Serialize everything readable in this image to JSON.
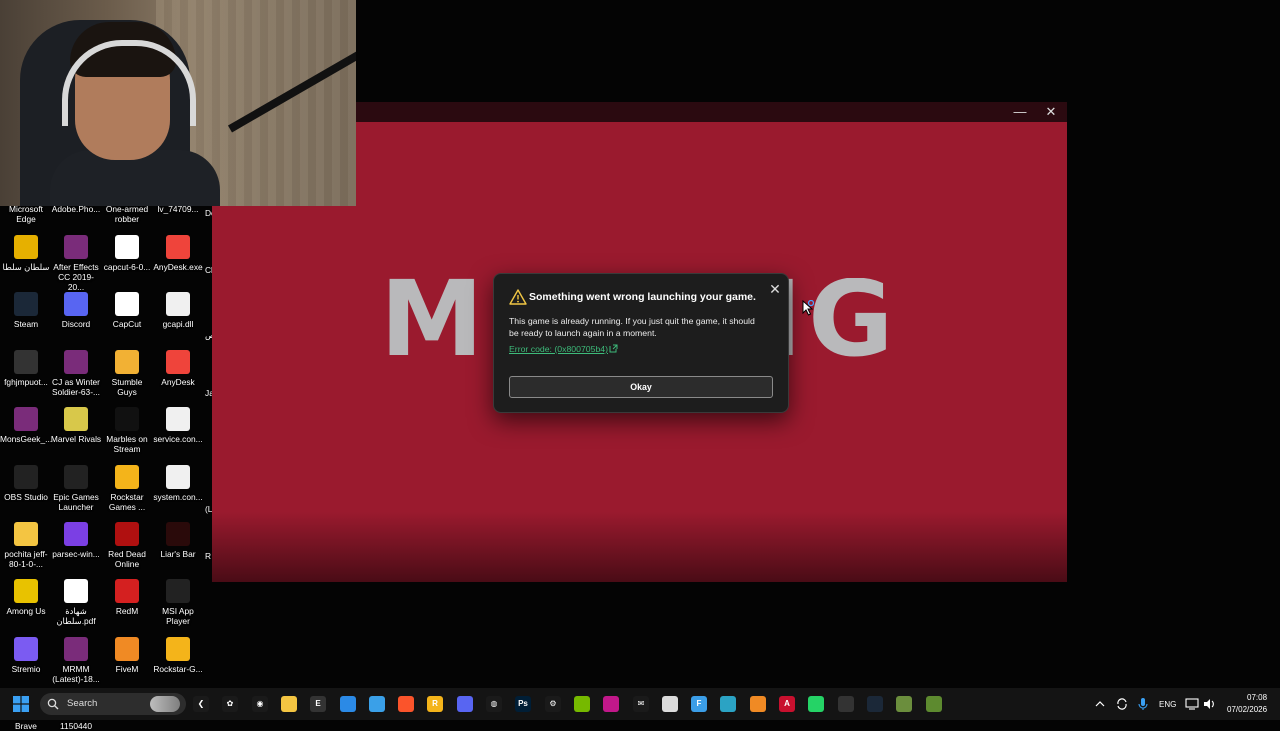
{
  "launcher": {
    "logo_text": "MOJANG",
    "minimize_glyph": "—",
    "close_glyph": "✕"
  },
  "dialog": {
    "title": "Something went wrong launching your game.",
    "message": "This game is already running. If you just quit the game, it should be ready to launch again in a moment.",
    "error_code": "Error code: (0x800705b4)",
    "ok_label": "Okay",
    "close_glyph": "✕"
  },
  "desktop": {
    "partial_top": [
      "Microsoft Edge",
      "Adobe.Pho...",
      "One-armed robber",
      "lv_74709..."
    ],
    "icons": [
      {
        "label": "سلطان سلطا",
        "icon": "chrome-icon",
        "color": "#e6b000"
      },
      {
        "label": "After Effects CC 2019-20...",
        "icon": "winrar-icon",
        "color": "#7a2c7a"
      },
      {
        "label": "capcut-6-0...",
        "icon": "capcut-icon",
        "color": "#ffffff"
      },
      {
        "label": "AnyDesk.exe",
        "icon": "anydesk-icon",
        "color": "#ef443b"
      },
      {
        "label": "Steam",
        "icon": "steam-icon",
        "color": "#1b2838"
      },
      {
        "label": "Discord",
        "icon": "discord-icon",
        "color": "#5865f2"
      },
      {
        "label": "CapCut",
        "icon": "capcut-icon",
        "color": "#ffffff"
      },
      {
        "label": "gcapi.dll",
        "icon": "file-icon",
        "color": "#f0f0f0"
      },
      {
        "label": "fghjmpuot...",
        "icon": "keyboard-icon",
        "color": "#333333"
      },
      {
        "label": "CJ as Winter Soldier-63-...",
        "icon": "winrar-icon",
        "color": "#7a2c7a"
      },
      {
        "label": "Stumble Guys",
        "icon": "stumble-guys-icon",
        "color": "#f2b134"
      },
      {
        "label": "AnyDesk",
        "icon": "anydesk-icon",
        "color": "#ef443b"
      },
      {
        "label": "MonsGeek_...",
        "icon": "winrar-icon",
        "color": "#7a2c7a"
      },
      {
        "label": "Marvel Rivals",
        "icon": "marvel-rivals-icon",
        "color": "#d8c84a"
      },
      {
        "label": "Marbles on Stream",
        "icon": "marbles-icon",
        "color": "#111111"
      },
      {
        "label": "service.con...",
        "icon": "file-icon",
        "color": "#f0f0f0"
      },
      {
        "label": "OBS Studio",
        "icon": "obs-icon",
        "color": "#222222"
      },
      {
        "label": "Epic Games Launcher",
        "icon": "epic-games-icon",
        "color": "#222222"
      },
      {
        "label": "Rockstar Games ...",
        "icon": "rockstar-icon",
        "color": "#f4b41a"
      },
      {
        "label": "system.con...",
        "icon": "file-icon",
        "color": "#f0f0f0"
      },
      {
        "label": "pochita jeff-80-1-0-...",
        "icon": "folder-icon",
        "color": "#f4c542"
      },
      {
        "label": "parsec-win...",
        "icon": "parsec-icon",
        "color": "#7b3fe4"
      },
      {
        "label": "Red Dead Online",
        "icon": "red-dead-icon",
        "color": "#b01010"
      },
      {
        "label": "Liar's Bar",
        "icon": "liars-bar-icon",
        "color": "#2a0a0a"
      },
      {
        "label": "Among Us",
        "icon": "among-us-icon",
        "color": "#e8c200"
      },
      {
        "label": "شهادة سلطان.pdf",
        "icon": "pdf-icon",
        "color": "#ffffff"
      },
      {
        "label": "RedM",
        "icon": "redm-icon",
        "color": "#d42020"
      },
      {
        "label": "MSI App Player",
        "icon": "msi-icon",
        "color": "#222222"
      },
      {
        "label": "Stremio",
        "icon": "stremio-icon",
        "color": "#7b5bf2"
      },
      {
        "label": "MRMM (Latest)-18...",
        "icon": "winrar-icon",
        "color": "#7a2c7a"
      },
      {
        "label": "FiveM",
        "icon": "fivem-icon",
        "color": "#f08a24"
      },
      {
        "label": "Rockstar-G...",
        "icon": "rockstar-icon",
        "color": "#f4b41a"
      },
      {
        "label": "Brave",
        "icon": "brave-icon",
        "color": "#fb542b"
      },
      {
        "label": "1150440",
        "icon": "chrome-icon",
        "color": "#ffffff"
      }
    ],
    "edge_fragments": [
      "De",
      "Cl",
      "ص",
      "Ja",
      "(L",
      "R"
    ]
  },
  "taskbar": {
    "search_placeholder": "Search",
    "apps": [
      {
        "icon": "task-view-icon",
        "color": "#1a1a1a",
        "glyph": "❮"
      },
      {
        "icon": "copilot-icon",
        "color": "#1a1a1a",
        "glyph": "✿"
      },
      {
        "icon": "chrome-icon",
        "color": "#1a1a1a",
        "glyph": "◉"
      },
      {
        "icon": "file-explorer-icon",
        "color": "#f4c542",
        "glyph": ""
      },
      {
        "icon": "epic-games-icon",
        "color": "#333333",
        "glyph": "E"
      },
      {
        "icon": "microsoft-store-icon",
        "color": "#2b8ae6",
        "glyph": ""
      },
      {
        "icon": "notepad-icon",
        "color": "#3aa0e8",
        "glyph": ""
      },
      {
        "icon": "brave-icon",
        "color": "#fb542b",
        "glyph": ""
      },
      {
        "icon": "rockstar-icon",
        "color": "#f4b41a",
        "glyph": "R"
      },
      {
        "icon": "discord-icon",
        "color": "#5865f2",
        "glyph": ""
      },
      {
        "icon": "xbox-app-icon",
        "color": "#1a1a1a",
        "glyph": "◍"
      },
      {
        "icon": "photoshop-icon",
        "color": "#001e36",
        "glyph": "Ps"
      },
      {
        "icon": "steam-client-icon",
        "color": "#1a1a1a",
        "glyph": "⚙"
      },
      {
        "icon": "nvidia-icon",
        "color": "#76b900",
        "glyph": ""
      },
      {
        "icon": "app-pink-icon",
        "color": "#c2188a",
        "glyph": ""
      },
      {
        "icon": "mail-icon",
        "color": "#1a1a1a",
        "glyph": "✉"
      },
      {
        "icon": "image-viewer-icon",
        "color": "#dcdcdc",
        "glyph": ""
      },
      {
        "icon": "app-f-icon",
        "color": "#3b9ee8",
        "glyph": "F"
      },
      {
        "icon": "globe-icon",
        "color": "#2ba3c4",
        "glyph": ""
      },
      {
        "icon": "app-orange-icon",
        "color": "#f08a24",
        "glyph": ""
      },
      {
        "icon": "app-red-a-icon",
        "color": "#c8102e",
        "glyph": "A"
      },
      {
        "icon": "whatsapp-icon",
        "color": "#25d366",
        "glyph": ""
      },
      {
        "icon": "app-dark-icon",
        "color": "#333333",
        "glyph": ""
      },
      {
        "icon": "steam-icon",
        "color": "#1b2838",
        "glyph": ""
      },
      {
        "icon": "minecraft-icon",
        "color": "#6b8e3d",
        "glyph": ""
      },
      {
        "icon": "minecraft-launcher-icon",
        "color": "#5d8a2f",
        "glyph": ""
      }
    ],
    "tray": {
      "language": "ENG",
      "time": "07:08",
      "date": "07/02/2026"
    }
  }
}
